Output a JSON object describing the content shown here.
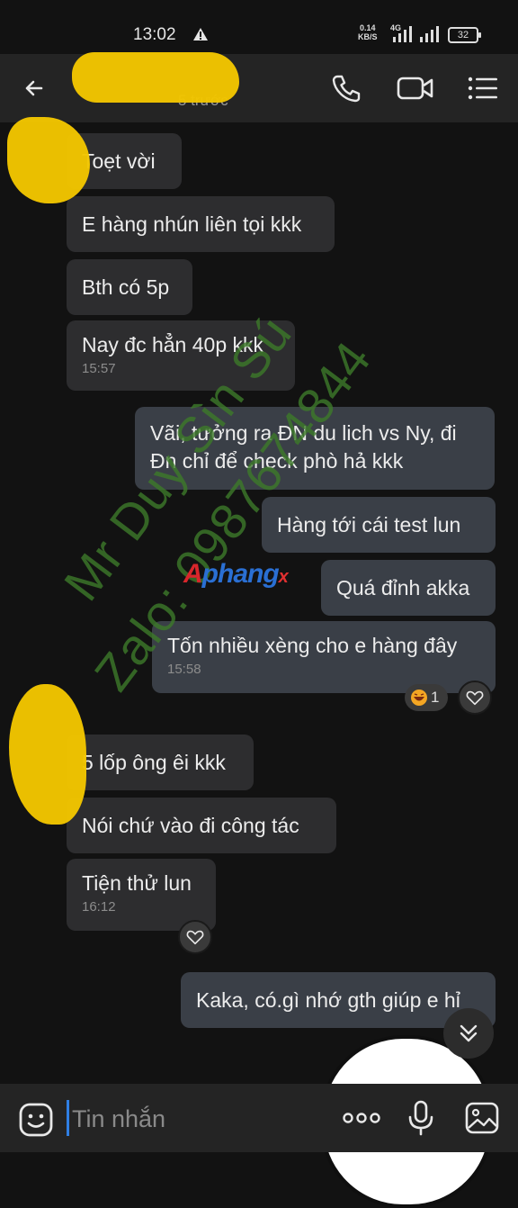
{
  "status_bar": {
    "time": "13:02",
    "net_speed": "0.14",
    "net_unit": "KB/S",
    "network": "4G",
    "battery": "32",
    "icons": [
      "warning-icon",
      "signal-icon",
      "battery-icon"
    ]
  },
  "header": {
    "subtitle": "5 trước",
    "icons": [
      "back-arrow-icon",
      "phone-icon",
      "video-call-icon",
      "menu-icon"
    ]
  },
  "messages": [
    {
      "direction": "in",
      "text": "Toẹt vời"
    },
    {
      "direction": "in",
      "text": "E hàng nhún liên tọi kkk"
    },
    {
      "direction": "in",
      "text": "Bth có 5p"
    },
    {
      "direction": "in",
      "text": "Nay đc hẳn 40p kkk",
      "time": "15:57"
    },
    {
      "direction": "out",
      "text": "Vãi, tưởng ra ĐN du lich vs Ny, đi",
      "text2": "Đn chỉ để check phò hả kkk"
    },
    {
      "direction": "out",
      "text": "Hàng tới cái test lun"
    },
    {
      "direction": "out",
      "text": "Quá đỉnh akka"
    },
    {
      "direction": "out",
      "text": "Tốn nhiều xèng cho e hàng đây",
      "time": "15:58",
      "reaction_count": "1"
    },
    {
      "direction": "in",
      "text": "5 lốp ông êi kkk"
    },
    {
      "direction": "in",
      "text": "Nói chứ vào đi công tác"
    },
    {
      "direction": "in",
      "text": "Tiện thử lun",
      "time": "16:12"
    },
    {
      "direction": "out",
      "text": "Kaka, có.gì nhớ gth giúp e hỉ"
    }
  ],
  "watermarks": {
    "line1": "Mr Duy Sìn Sú",
    "line2": "Zalo: 0987674844",
    "logo_a": "A",
    "logo_rest": "phang",
    "logo_x": "x"
  },
  "composer": {
    "placeholder": "Tin nhắn",
    "icons": [
      "emoji-icon",
      "more-icon",
      "microphone-icon",
      "image-icon"
    ]
  },
  "colors": {
    "background": "#121212",
    "incoming_bubble": "#2d2d2f",
    "outgoing_bubble": "#3a3f47",
    "bar": "#242424",
    "accent": "#2f7fe4",
    "redaction": "#f2c500",
    "watermark": "#3d7a2a"
  }
}
